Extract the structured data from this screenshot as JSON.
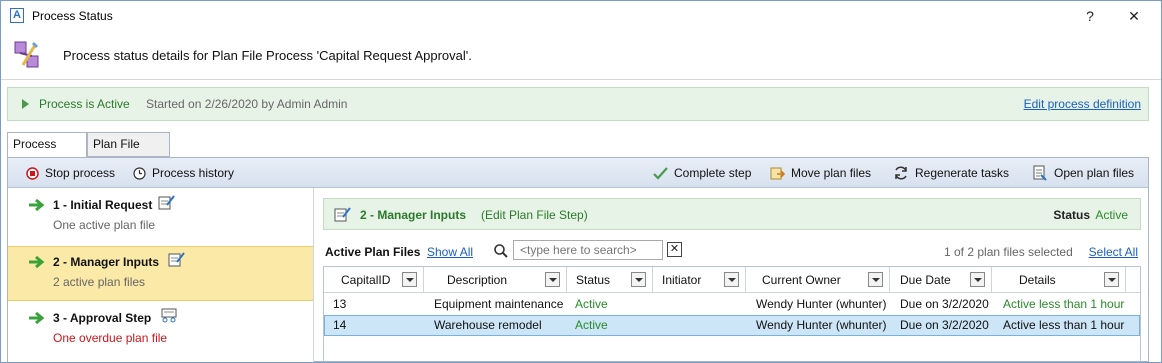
{
  "window": {
    "title": "Process Status",
    "help": "?",
    "close": "✕"
  },
  "header": {
    "message": "Process status details for Plan File Process 'Capital Request Approval'."
  },
  "banner": {
    "status": "Process is Active",
    "started": "Started on 2/26/2020 by Admin Admin",
    "link": "Edit process definition"
  },
  "tabs": [
    {
      "label": "Process View"
    },
    {
      "label": "Plan File View"
    }
  ],
  "toolbar": {
    "stop": "Stop process",
    "history": "Process history",
    "complete": "Complete step",
    "move": "Move plan files",
    "regenerate": "Regenerate tasks",
    "open": "Open plan files"
  },
  "steps": [
    {
      "title": "1 - Initial Request",
      "sub": "One active plan file"
    },
    {
      "title": "2 - Manager Inputs",
      "sub": "2 active plan files"
    },
    {
      "title": "3 - Approval Step",
      "sub": "One overdue plan file"
    }
  ],
  "step_detail": {
    "title": "2 - Manager Inputs",
    "kind": "(Edit Plan File Step)",
    "status_label": "Status",
    "status_value": "Active"
  },
  "plan_files": {
    "label": "Active Plan Files",
    "show_all": "Show All",
    "search_placeholder": "<type here to search>",
    "clear": "✕",
    "selected_count": "1 of 2 plan files selected",
    "select_all": "Select All",
    "columns": [
      "CapitalID",
      "Description",
      "Status",
      "Initiator",
      "Current Owner",
      "Due Date",
      "Details"
    ],
    "rows": [
      {
        "id": "13",
        "description": "Equipment maintenance",
        "status": "Active",
        "initiator": "",
        "owner": "Wendy Hunter (whunter)",
        "due": "Due on 3/2/2020",
        "details": "Active less than 1 hour"
      },
      {
        "id": "14",
        "description": "Warehouse remodel",
        "status": "Active",
        "initiator": "",
        "owner": "Wendy Hunter (whunter)",
        "due": "Due on 3/2/2020",
        "details": "Active less than 1 hour"
      }
    ]
  },
  "colors": {
    "accent_green": "#2a7a2a",
    "link_blue": "#1a5fc0",
    "selected_step": "#fbe9a7",
    "selected_row": "#cde6f7",
    "overdue_red": "#d0141b"
  }
}
